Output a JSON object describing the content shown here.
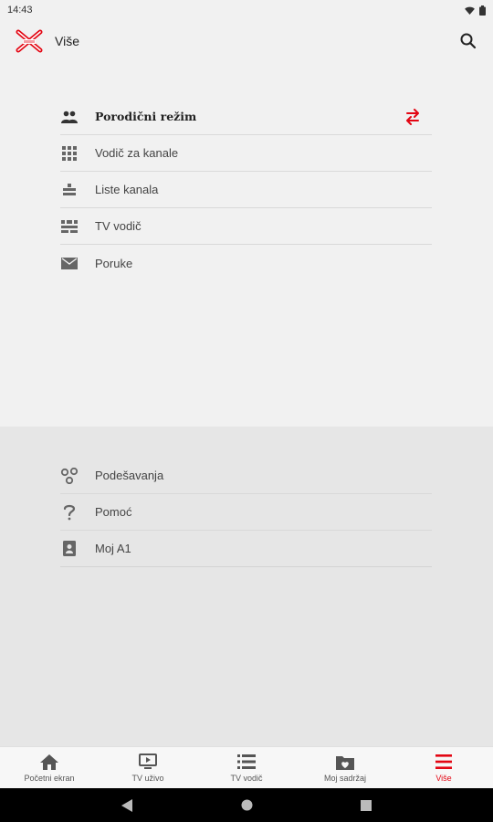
{
  "status": {
    "time": "14:43"
  },
  "appbar": {
    "title": "Više",
    "logo": "a1-xtv-logo",
    "search_icon": "search-icon"
  },
  "menu_top": [
    {
      "label": "Porodični režim",
      "icon": "family-icon",
      "bold": true,
      "trailing_icon": "switch-icon"
    },
    {
      "label": "Vodič za kanale",
      "icon": "grid-icon"
    },
    {
      "label": "Liste kanala",
      "icon": "channel-list-icon"
    },
    {
      "label": "TV vodič",
      "icon": "tv-guide-icon"
    },
    {
      "label": "Poruke",
      "icon": "mail-icon"
    }
  ],
  "menu_bottom": [
    {
      "label": "Podešavanja",
      "icon": "settings-icon"
    },
    {
      "label": "Pomoć",
      "icon": "help-icon"
    },
    {
      "label": "Moj A1",
      "icon": "account-icon"
    }
  ],
  "bottom_nav": [
    {
      "label": "Početni ekran",
      "icon": "home-icon"
    },
    {
      "label": "TV uživo",
      "icon": "live-tv-icon"
    },
    {
      "label": "TV vodič",
      "icon": "list-icon"
    },
    {
      "label": "Moj sadržaj",
      "icon": "heart-folder-icon"
    },
    {
      "label": "Više",
      "icon": "menu-icon",
      "active": true
    }
  ],
  "colors": {
    "accent": "#e30613",
    "icon": "#555555",
    "background": "#f1f1f1",
    "lower_panel": "#e6e6e6"
  }
}
